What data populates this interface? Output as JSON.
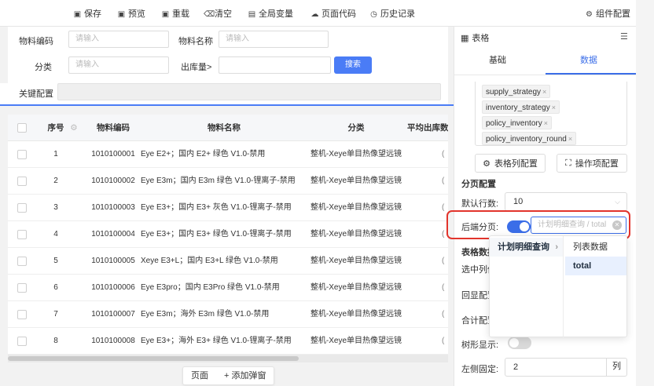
{
  "toolbar": {
    "save": "保存",
    "preview": "预览",
    "reload": "重载",
    "clear": "清空",
    "global_vars": "全局变量",
    "page_code": "页面代码",
    "history": "历史记录",
    "component_config": "组件配置"
  },
  "form": {
    "material_code_label": "物料编码",
    "material_code_placeholder": "请输入",
    "material_name_label": "物料名称",
    "material_name_placeholder": "请输入",
    "category_label": "分类",
    "category_placeholder": "请输入",
    "outbound_label": "出库量>",
    "search_button": "搜索",
    "keyword_config_label": "关键配置"
  },
  "table": {
    "headers": [
      "序号",
      "物料编码",
      "物料名称",
      "分类",
      "平均出库数"
    ],
    "rows": [
      {
        "no": "1",
        "code": "1010100001",
        "name": "Eye E2+；国内 E2+ 绿色 V1.0-禁用",
        "category": "整机-Xeye单目热像望远镜"
      },
      {
        "no": "2",
        "code": "1010100002",
        "name": "Eye E3m；国内 E3m 绿色 V1.0-锂离子-禁用",
        "category": "整机-Xeye单目热像望远镜"
      },
      {
        "no": "3",
        "code": "1010100003",
        "name": "Eye E3+；国内 E3+ 灰色 V1.0-锂离子-禁用",
        "category": "整机-Xeye单目热像望远镜"
      },
      {
        "no": "4",
        "code": "1010100004",
        "name": "Eye E3+；国内 E3+ 绿色 V1.0-锂离子-禁用",
        "category": "整机-Xeye单目热像望远镜"
      },
      {
        "no": "5",
        "code": "1010100005",
        "name": "Xeye E3+L；国内 E3+L 绿色 V1.0-禁用",
        "category": "整机-Xeye单目热像望远镜"
      },
      {
        "no": "6",
        "code": "1010100006",
        "name": "Eye E3pro；国内 E3Pro 绿色 V1.0-禁用",
        "category": "整机-Xeye单目热像望远镜"
      },
      {
        "no": "7",
        "code": "1010100007",
        "name": "Eye E3m；海外 E3m 绿色 V1.0-禁用",
        "category": "整机-Xeye单目热像望远镜"
      },
      {
        "no": "8",
        "code": "1010100008",
        "name": "Eye E3+；海外 E3+ 绿色 V1.0-锂离子-禁用",
        "category": "整机-Xeye单目热像望远镜"
      }
    ]
  },
  "bottom_bar": {
    "page": "页面",
    "add_popup": "+ 添加弹窗"
  },
  "panel": {
    "title": "表格",
    "tab_basic": "基础",
    "tab_data": "数据",
    "tags": [
      "supply_strategy",
      "inventory_strategy",
      "policy_inventory",
      "policy_inventory_round"
    ],
    "table_column_config": "表格列配置",
    "action_config": "操作项配置",
    "paging_section": "分页配置",
    "default_rows_label": "默认行数:",
    "default_rows_value": "10",
    "backend_paging_label": "后端分页:",
    "cascader_placeholder": "计划明细查询 / total",
    "table_data_label": "表格数据",
    "selected_col_label": "选中列值",
    "echo_config_label": "回显配置",
    "sum_config_label": "合计配置",
    "tree_display_label": "树形显示:",
    "left_fixed_label": "左侧固定:",
    "left_fixed_value": "2",
    "left_fixed_unit": "列"
  },
  "cascader": {
    "level1": [
      "计划明细查询"
    ],
    "level2": [
      "列表数据",
      "total"
    ]
  },
  "colors": {
    "accent": "#3b6ee8",
    "search_button": "#4a7cf6",
    "highlight": "#e2342c"
  }
}
